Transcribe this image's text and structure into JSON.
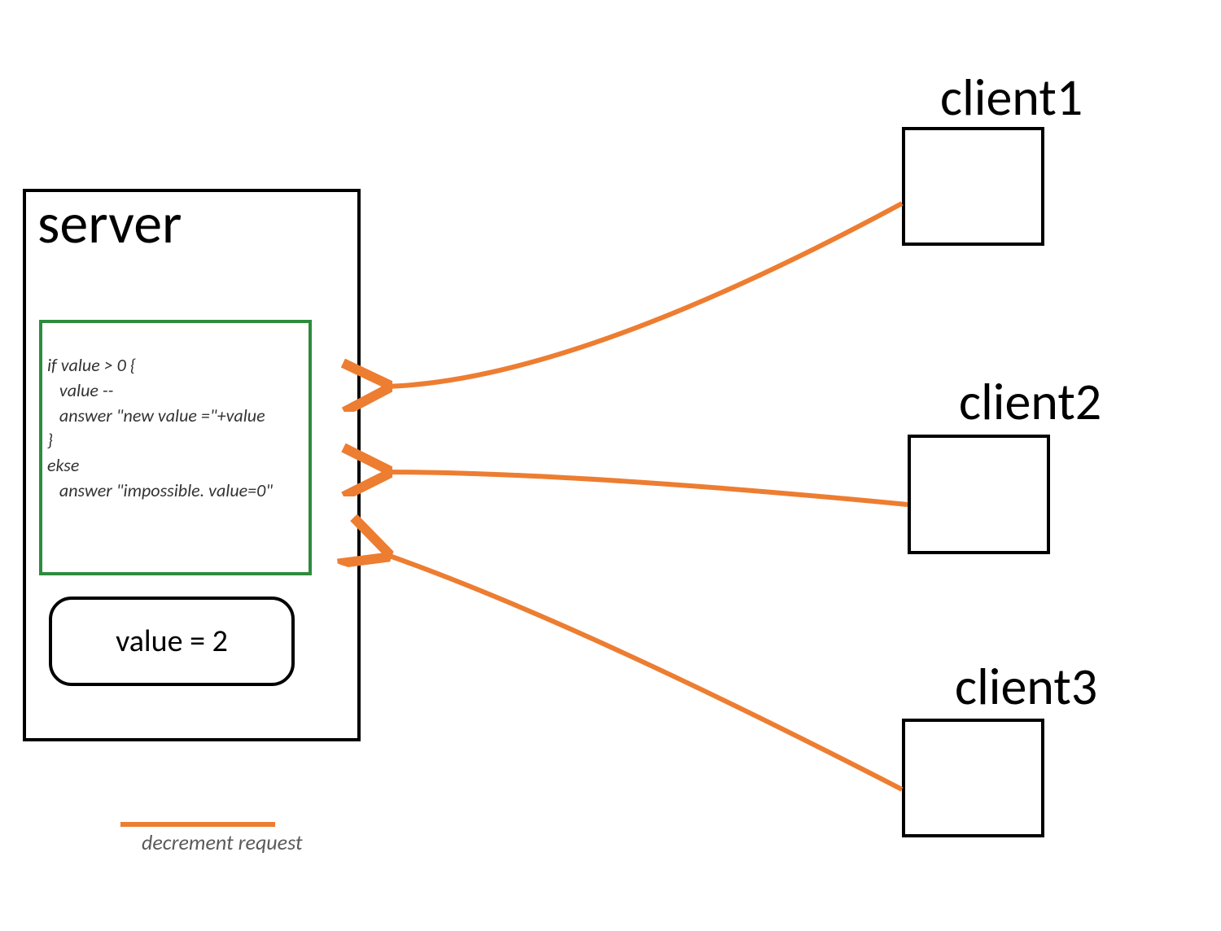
{
  "server": {
    "label": "server",
    "code": "if value > 0 {\n   value --\n   answer \"new value =\"+value\n}\nekse\n   answer \"impossible. value=0\"",
    "value_text": "value = 2"
  },
  "clients": {
    "c1": "client1",
    "c2": "client2",
    "c3": "client3"
  },
  "legend": {
    "text": "decrement request"
  },
  "colors": {
    "arrow": "#ed7d31",
    "code_border": "#2e8b3d"
  }
}
